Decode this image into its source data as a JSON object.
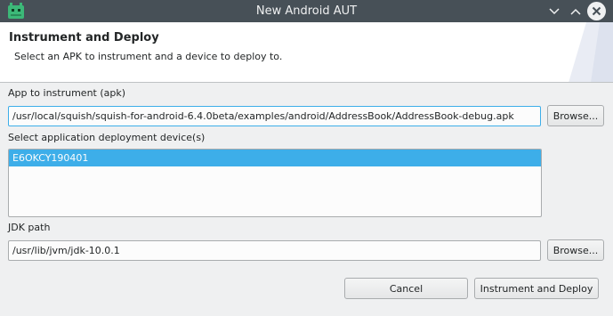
{
  "window": {
    "title": "New Android AUT",
    "icon": "android-icon"
  },
  "header": {
    "title": "Instrument and Deploy",
    "description": "Select an APK to instrument and a device to deploy to."
  },
  "apk": {
    "label": "App to instrument (apk)",
    "value": "/usr/local/squish/squish-for-android-6.4.0beta/examples/android/AddressBook/AddressBook-debug.apk",
    "browse_label": "Browse..."
  },
  "device": {
    "label": "Select application deployment device(s)",
    "items": [
      {
        "label": "E6OKCY190401",
        "selected": true
      }
    ]
  },
  "jdk": {
    "label": "JDK path",
    "value": "/usr/lib/jvm/jdk-10.0.1",
    "browse_label": "Browse..."
  },
  "buttons": {
    "cancel_label": "Cancel",
    "deploy_label": "Instrument and Deploy"
  },
  "colors": {
    "titlebar": "#475057",
    "selection": "#3daee9",
    "window_bg": "#eff0f1"
  }
}
